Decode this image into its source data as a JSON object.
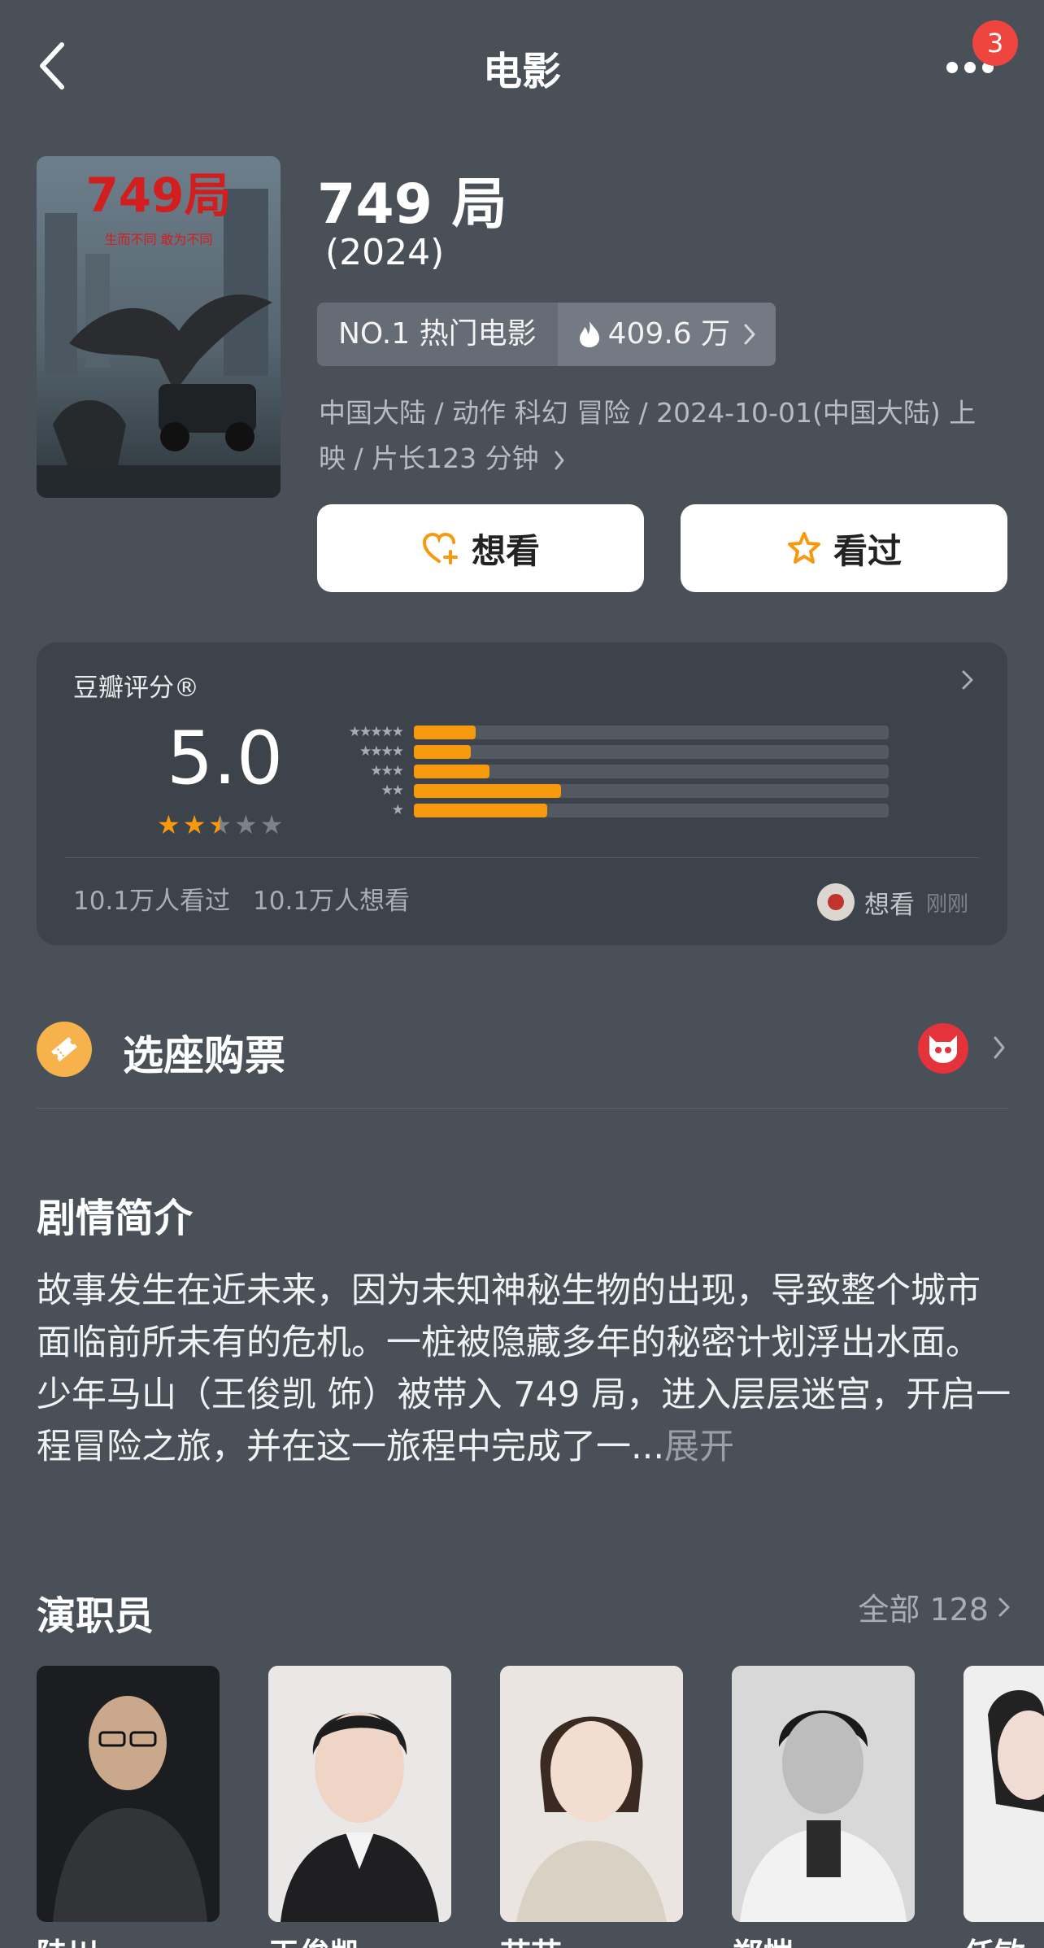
{
  "header": {
    "title": "电影",
    "notification_count": "3"
  },
  "movie": {
    "title": "749 局",
    "year": "(2024)",
    "rank_label": "NO.1 热门电影",
    "heat": "409.6 万",
    "meta": "中国大陆 / 动作 科幻 冒险 / 2024-10-01(中国大陆) 上映 / 片长123 分钟",
    "want_label": "想看",
    "watched_label": "看过",
    "poster_title_text": "749局",
    "poster_tagline": "生而不同  敢为不同"
  },
  "rating": {
    "label": "豆瓣评分®",
    "score": "5.0",
    "stars": 2.5,
    "distribution": [
      0.13,
      0.12,
      0.16,
      0.31,
      0.28
    ],
    "watched_count": "10.1万人看过",
    "want_count": "10.1万人想看",
    "recent_action": "想看",
    "recent_time": "刚刚"
  },
  "tickets": {
    "label": "选座购票"
  },
  "synopsis": {
    "title": "剧情简介",
    "text": "故事发生在近未来，因为未知神秘生物的出现，导致整个城市面临前所未有的危机。一桩被隐藏多年的秘密计划浮出水面。少年马山（王俊凯 饰）被带入 749 局，进入层层迷宫，开启一程冒险之旅，并在这一旅程中完成了一...",
    "expand_label": "展开"
  },
  "cast": {
    "title": "演职员",
    "all_label": "全部 128",
    "members": [
      "陆川",
      "王俊凯",
      "苗苗",
      "郑恺",
      "任敏"
    ]
  },
  "colors": {
    "accent": "#f6990d",
    "background": "#4a5058",
    "card": "#3d434a",
    "badge": "#f0443f"
  }
}
